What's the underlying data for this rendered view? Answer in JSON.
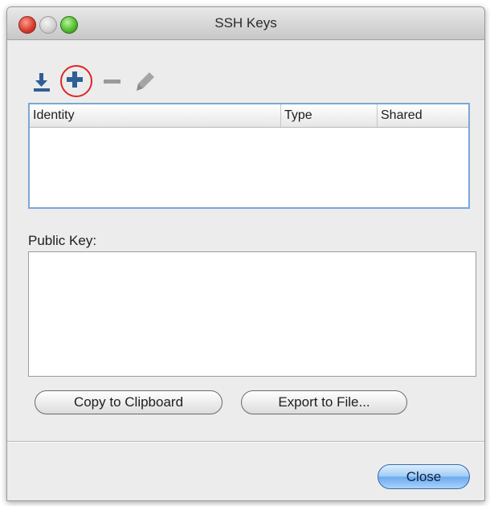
{
  "window": {
    "title": "SSH Keys"
  },
  "toolbar": {
    "icons": [
      "import-icon",
      "add-icon",
      "remove-icon",
      "edit-icon"
    ],
    "add_highlight_color": "#e02525"
  },
  "table": {
    "columns": [
      "Identity",
      "Type",
      "Shared"
    ],
    "rows": []
  },
  "public_key": {
    "label": "Public Key:",
    "value": ""
  },
  "buttons": {
    "copy": "Copy to Clipboard",
    "export": "Export to File...",
    "close": "Close"
  },
  "colors": {
    "table_border": "#7aa7d6",
    "default_button": "#6aaaf0"
  }
}
